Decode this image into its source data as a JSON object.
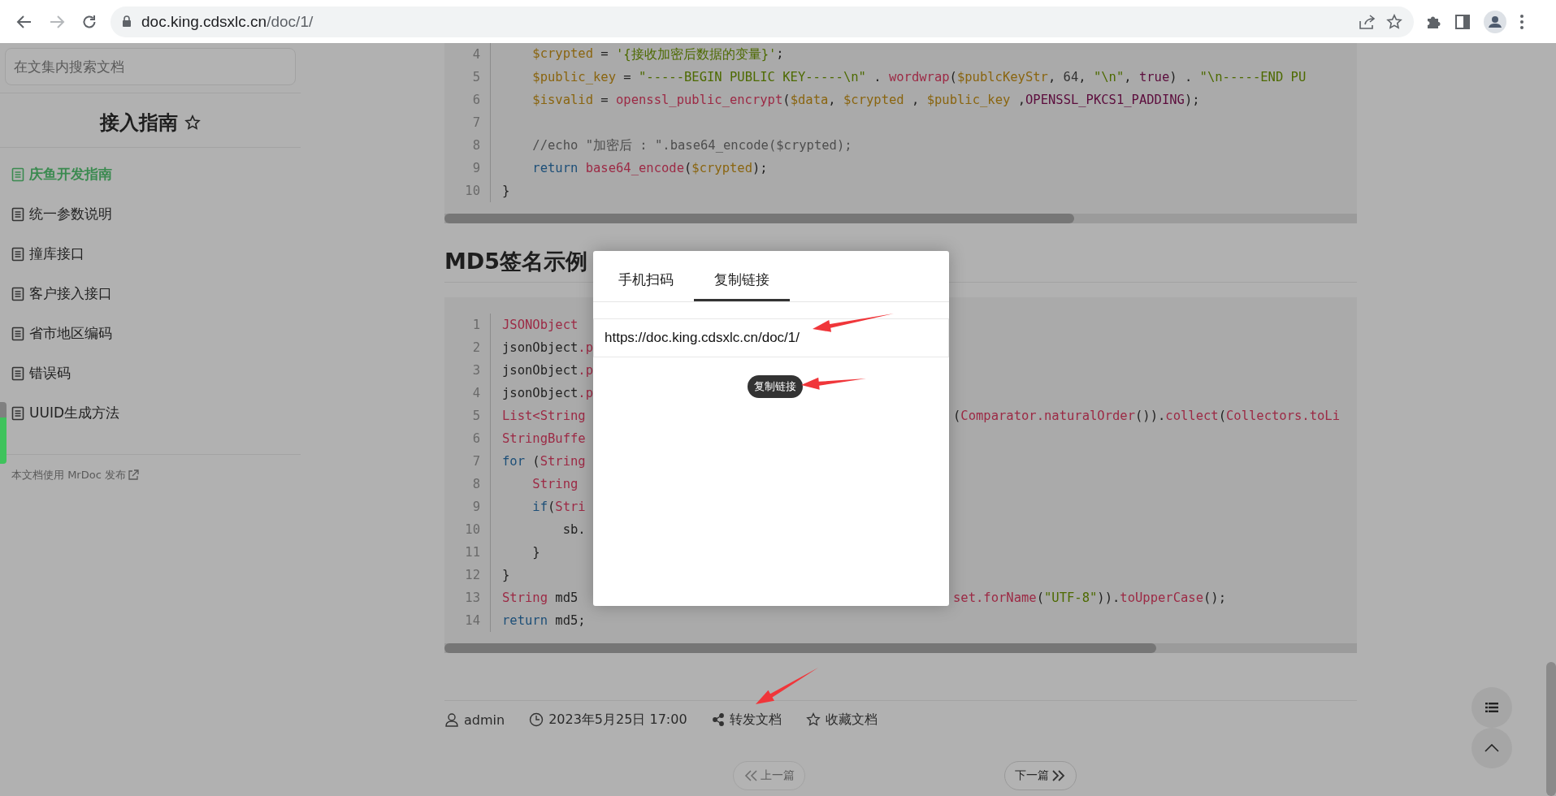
{
  "browser": {
    "url_host": "doc.king.cdsxlc.cn",
    "url_path": "/doc/1/"
  },
  "sidebar": {
    "search": {
      "placeholder": "在文集内搜索文档"
    },
    "title": "接入指南",
    "items": [
      {
        "label": "庆鱼开发指南",
        "selected": true
      },
      {
        "label": "统一参数说明",
        "selected": false
      },
      {
        "label": "撞库接口",
        "selected": false
      },
      {
        "label": "客户接入接口",
        "selected": false
      },
      {
        "label": "省市地区编码",
        "selected": false
      },
      {
        "label": "错误码",
        "selected": false
      },
      {
        "label": "UUID生成方法",
        "selected": false
      }
    ],
    "footer": "本文档使用 MrDoc 发布"
  },
  "code_blocks": [
    {
      "lines": [
        {
          "number": "4",
          "left": [
            {
              "text": "    $crypted",
              "kind": "var"
            },
            {
              "text": " = ",
              "kind": "plain"
            },
            {
              "text": "'{接收加密后数据的变量}'",
              "kind": "str"
            },
            {
              "text": ";",
              "kind": "plain"
            }
          ]
        },
        {
          "number": "5",
          "left": [
            {
              "text": "    $public_key",
              "kind": "var"
            },
            {
              "text": " = ",
              "kind": "plain"
            },
            {
              "text": "\"-----BEGIN PUBLIC KEY-----\\n\"",
              "kind": "str"
            },
            {
              "text": " . ",
              "kind": "plain"
            },
            {
              "text": "wordwrap",
              "kind": "fn"
            },
            {
              "text": "(",
              "kind": "plain"
            },
            {
              "text": "$publcKeyStr",
              "kind": "var"
            },
            {
              "text": ", ",
              "kind": "plain"
            },
            {
              "text": "64",
              "kind": "num"
            },
            {
              "text": ", ",
              "kind": "plain"
            },
            {
              "text": "\"\\n\"",
              "kind": "str"
            },
            {
              "text": ", ",
              "kind": "plain"
            },
            {
              "text": "true",
              "kind": "const"
            },
            {
              "text": ") . ",
              "kind": "plain"
            },
            {
              "text": "\"\\n-----END PU",
              "kind": "str"
            }
          ]
        },
        {
          "number": "6",
          "left": [
            {
              "text": "    $isvalid",
              "kind": "var"
            },
            {
              "text": " = ",
              "kind": "plain"
            },
            {
              "text": "openssl_public_encrypt",
              "kind": "fn"
            },
            {
              "text": "(",
              "kind": "plain"
            },
            {
              "text": "$data",
              "kind": "var"
            },
            {
              "text": ", ",
              "kind": "plain"
            },
            {
              "text": "$crypted",
              "kind": "var"
            },
            {
              "text": " , ",
              "kind": "plain"
            },
            {
              "text": "$public_key",
              "kind": "var"
            },
            {
              "text": " ,",
              "kind": "plain"
            },
            {
              "text": "OPENSSL_PKCS1_PADDING",
              "kind": "const"
            },
            {
              "text": ");",
              "kind": "plain"
            }
          ]
        },
        {
          "number": "7"
        },
        {
          "number": "8",
          "left": [
            {
              "text": "    //echo \"加密后 : \".base64_encode($crypted);",
              "kind": "comment"
            }
          ]
        },
        {
          "number": "9",
          "left": [
            {
              "text": "    return",
              "kind": "kw"
            },
            {
              "text": " base64_encode",
              "kind": "fn"
            },
            {
              "text": "(",
              "kind": "plain"
            },
            {
              "text": "$crypted",
              "kind": "var"
            },
            {
              "text": ");",
              "kind": "plain"
            }
          ]
        },
        {
          "number": "10",
          "left": [
            {
              "text": "}",
              "kind": "plain"
            }
          ]
        }
      ]
    },
    {
      "lines": [
        {
          "number": "1",
          "left": [
            {
              "text": "JSONObject",
              "kind": "type"
            }
          ]
        },
        {
          "number": "2",
          "left": [
            {
              "text": "jsonObject",
              "kind": "plain"
            },
            {
              "text": ".p",
              "kind": "fn"
            }
          ]
        },
        {
          "number": "3",
          "left": [
            {
              "text": "jsonObject",
              "kind": "plain"
            },
            {
              "text": ".p",
              "kind": "fn"
            }
          ]
        },
        {
          "number": "4",
          "left": [
            {
              "text": "jsonObject",
              "kind": "plain"
            },
            {
              "text": ".p",
              "kind": "fn"
            }
          ]
        },
        {
          "number": "5",
          "left": [
            {
              "text": "List<String",
              "kind": "type"
            }
          ],
          "right": [
            {
              "text": "(",
              "kind": "plain"
            },
            {
              "text": "Comparator.naturalOrder",
              "kind": "fn"
            },
            {
              "text": "()).",
              "kind": "plain"
            },
            {
              "text": "collect",
              "kind": "fn"
            },
            {
              "text": "(",
              "kind": "plain"
            },
            {
              "text": "Collectors.toLi",
              "kind": "fn"
            }
          ]
        },
        {
          "number": "6",
          "left": [
            {
              "text": "StringBuffe",
              "kind": "type"
            }
          ]
        },
        {
          "number": "7",
          "left": [
            {
              "text": "for",
              "kind": "kw"
            },
            {
              "text": " (",
              "kind": "plain"
            },
            {
              "text": "String",
              "kind": "type"
            }
          ]
        },
        {
          "number": "8",
          "left": [
            {
              "text": "    String",
              "kind": "type"
            }
          ]
        },
        {
          "number": "9",
          "left": [
            {
              "text": "    if",
              "kind": "kw"
            },
            {
              "text": "(",
              "kind": "plain"
            },
            {
              "text": "Stri",
              "kind": "type"
            }
          ]
        },
        {
          "number": "10",
          "left": [
            {
              "text": "        sb.",
              "kind": "plain"
            }
          ]
        },
        {
          "number": "11",
          "left": [
            {
              "text": "    }",
              "kind": "plain"
            }
          ]
        },
        {
          "number": "12",
          "left": [
            {
              "text": "}",
              "kind": "plain"
            }
          ]
        },
        {
          "number": "13",
          "left": [
            {
              "text": "String",
              "kind": "type"
            },
            {
              "text": " md5",
              "kind": "plain"
            }
          ],
          "right": [
            {
              "text": "set.forName",
              "kind": "fn"
            },
            {
              "text": "(",
              "kind": "plain"
            },
            {
              "text": "\"UTF-8\"",
              "kind": "str"
            },
            {
              "text": ")).",
              "kind": "plain"
            },
            {
              "text": "toUpperCase",
              "kind": "fn"
            },
            {
              "text": "();",
              "kind": "plain"
            }
          ]
        },
        {
          "number": "14",
          "left": [
            {
              "text": "return",
              "kind": "kw"
            },
            {
              "text": " md5;",
              "kind": "plain"
            }
          ]
        }
      ]
    }
  ],
  "heading": "MD5签名示例",
  "meta": [
    {
      "kind": "user",
      "text": "admin"
    },
    {
      "kind": "time",
      "text": "2023年5月25日 17:00"
    },
    {
      "kind": "share",
      "text": "转发文档"
    },
    {
      "kind": "star",
      "text": "收藏文档"
    }
  ],
  "pager": {
    "prev": {
      "label": "上一篇",
      "disabled": true
    },
    "next": {
      "label": "下一篇",
      "disabled": false
    }
  },
  "modal": {
    "tabs": [
      {
        "label": "手机扫码",
        "selected": false
      },
      {
        "label": "复制链接",
        "selected": true
      }
    ],
    "url_value": "https://doc.king.cdsxlc.cn/doc/1/",
    "copy_button": "复制链接"
  }
}
